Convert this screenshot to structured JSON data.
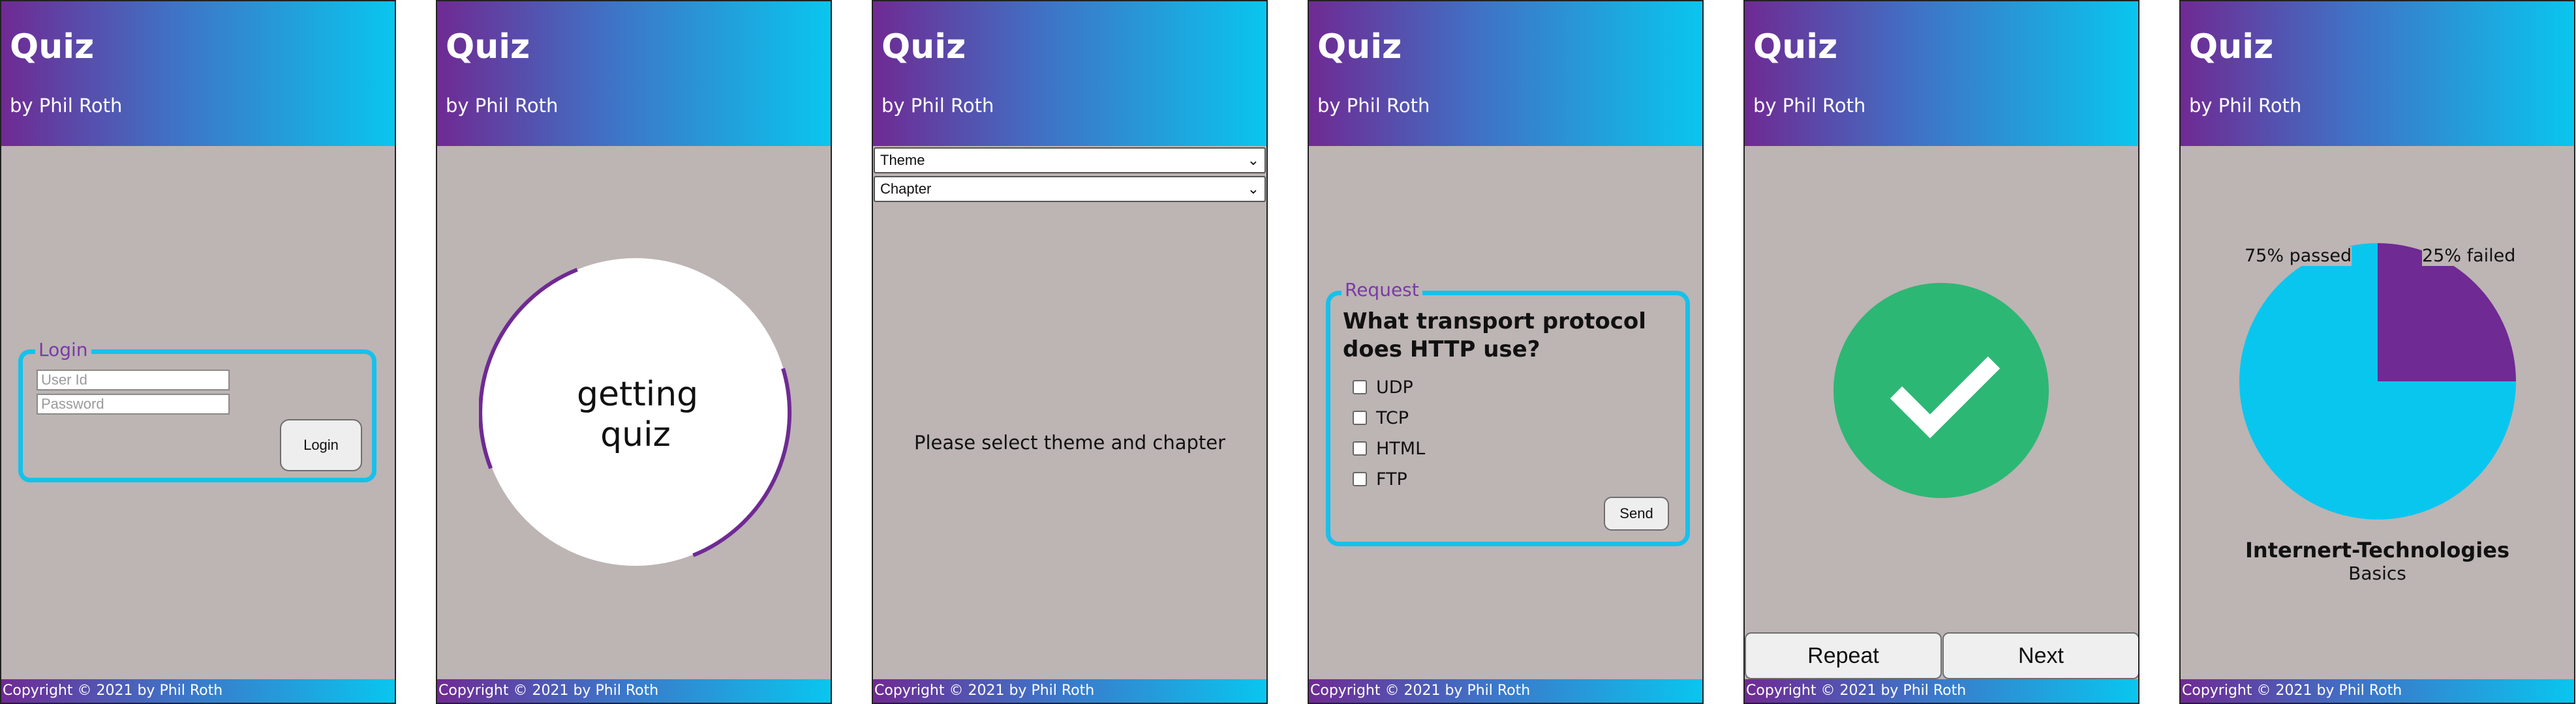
{
  "app": {
    "title": "Quiz",
    "subtitle": "by Phil Roth",
    "footer": "Copyright © 2021 by Phil Roth"
  },
  "login": {
    "legend": "Login",
    "user_placeholder": "User Id",
    "password_placeholder": "Password",
    "button": "Login"
  },
  "loading": {
    "line1": "getting",
    "line2": "quiz"
  },
  "selection": {
    "theme_select": "Theme",
    "chapter_select": "Chapter",
    "message": "Please select theme and chapter"
  },
  "question": {
    "legend": "Request",
    "text": "What transport protocol does HTTP use?",
    "options": [
      "UDP",
      "TCP",
      "HTML",
      "FTP"
    ],
    "send": "Send"
  },
  "result": {
    "repeat": "Repeat",
    "next": "Next"
  },
  "stats": {
    "passed_label": "75% passed",
    "failed_label": "25% failed",
    "topic": "Internert-Technologies",
    "chapter": "Basics"
  },
  "chart_data": {
    "type": "pie",
    "categories": [
      "passed",
      "failed"
    ],
    "values": [
      75,
      25
    ],
    "labels": [
      "75% passed",
      "25% failed"
    ],
    "colors": [
      "#09c6ee",
      "#6f2a93"
    ]
  },
  "colors": {
    "accent_purple": "#6f2a93",
    "accent_cyan": "#09c6ee",
    "success_green": "#2db774",
    "background": "#bdb4b4"
  }
}
